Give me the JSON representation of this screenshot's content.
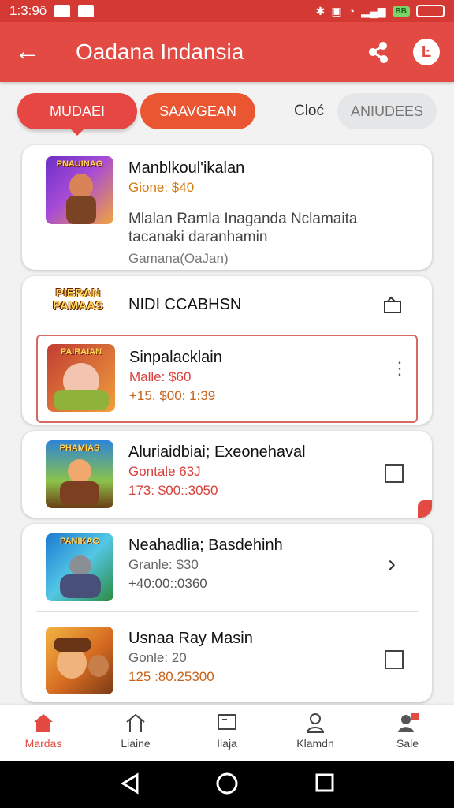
{
  "status_bar": {
    "time": "1:3:9ô",
    "right_badge": "BB"
  },
  "app_bar": {
    "title": "Oadana Indansia",
    "back_icon": "back-arrow-icon",
    "share_icon": "share-icon",
    "profile_icon": "profile-icon"
  },
  "tabs": [
    {
      "label": "MUDAEI"
    },
    {
      "label": "SAAVGEAN"
    },
    {
      "label": "Cloć"
    },
    {
      "label": "ANIUDEES"
    }
  ],
  "cards": [
    {
      "title": "Manblkoul'ikalan",
      "subtitle": "Gione: $40",
      "description_line1": "Mlalan Ramla Inaganda Nclamaita",
      "description_line2": "tacanaki daranhamin",
      "footer": "Gamana(OaJan)",
      "thumb_text": "PNAUINAG"
    },
    {
      "header_logo": "PIERAN PAMAAS",
      "header_title": "NIDI CCABHSN",
      "header_icon": "folder-icon",
      "title": "Sinpalacklain",
      "subtitle": "Malle: $60",
      "meta": "+15. $00: 1:39",
      "thumb_text": "PAIRAIAN",
      "right_icon": "more-vertical-icon"
    },
    {
      "title": "Aluriaidbiai; Exeonehaval",
      "subtitle": "Gontale 63J",
      "meta": "173: $00::3050",
      "thumb_text": "PHAMIAS",
      "right_icon": "checkbox-icon"
    },
    {
      "title": "Neahadlia; Basdehinh",
      "subtitle": "Granle: $30",
      "meta": "+40:00::0360",
      "thumb_text": "PANIKAG",
      "right_icon": "chevron-right-icon"
    },
    {
      "title": "Usnaa Ray Masin",
      "subtitle": "Gonle: 20",
      "meta": "125 :80.25300",
      "thumb_text": "",
      "right_icon": "checkbox-icon"
    }
  ],
  "bottom_nav": [
    {
      "label": "Mardas",
      "icon": "home-icon"
    },
    {
      "label": "Liaine",
      "icon": "house-outline-icon"
    },
    {
      "label": "Ilaja",
      "icon": "monitor-icon"
    },
    {
      "label": "Klamdn",
      "icon": "user-icon"
    },
    {
      "label": "Sale",
      "icon": "user-badge-icon"
    }
  ],
  "colors": {
    "primary": "#e24a43",
    "accent_orange": "#ea5532",
    "text": "#222222"
  }
}
